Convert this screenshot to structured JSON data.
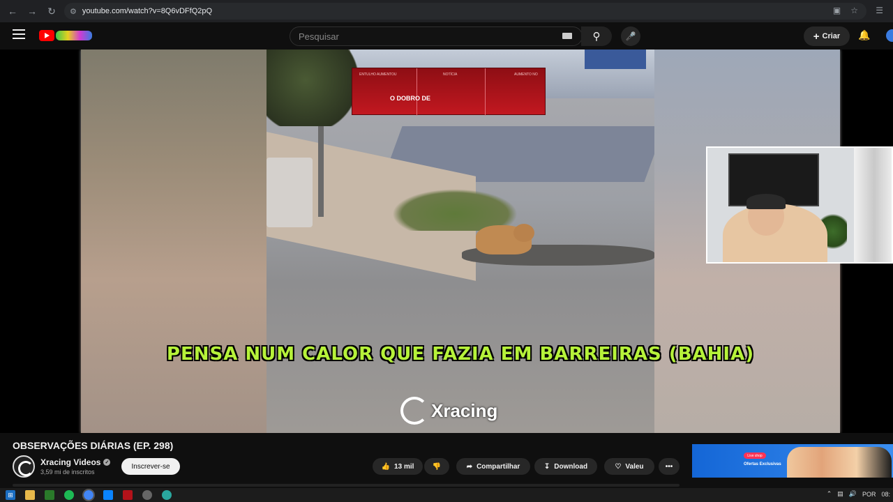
{
  "browser": {
    "url": "youtube.com/watch?v=8Q6vDFfQ2pQ",
    "back_icon": "back-arrow-icon",
    "forward_icon": "forward-arrow-icon",
    "reload_icon": "reload-icon"
  },
  "header": {
    "search_placeholder": "Pesquisar",
    "create_label": "Criar"
  },
  "video": {
    "caption": "PENSA NUM CALOR QUE FAZIA EM BARREIRAS (BAHIA)",
    "watermark": "Xracing",
    "news_banner_headline": "O DOBRO DE",
    "news_banner_tiny": [
      "ENTULHO AUMENTOU",
      "NOTÍCIA",
      "AUMENTO NO"
    ]
  },
  "meta": {
    "title": "OBSERVAÇÕES DIÁRIAS (EP. 298)",
    "channel_name": "Xracing Videos",
    "subscribers": "3,59 mi de inscritos",
    "subscribe_label": "Inscrever-se",
    "likes": "13 mil",
    "share_label": "Compartilhar",
    "download_label": "Download",
    "thanks_label": "Valeu",
    "more_label": "•••"
  },
  "ad": {
    "badge": "Live shop",
    "text": "Ofertas Exclusivas"
  },
  "taskbar": {
    "lang": "POR",
    "time": "08:"
  },
  "colors": {
    "caption": "#b6f23a",
    "yt_red": "#ff0000",
    "background": "#0f0f0f"
  }
}
